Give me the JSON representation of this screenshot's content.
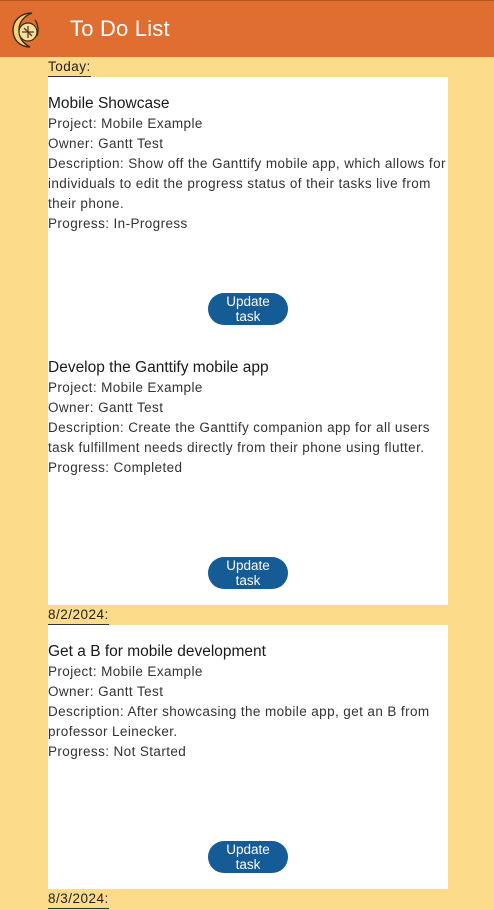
{
  "app": {
    "title": "To Do List",
    "logo_icon": "ganttify-logo-icon",
    "colors": {
      "appbar": "#E06E30",
      "background": "#FCDC8A",
      "button": "#155B96",
      "card": "#FFFFFF"
    }
  },
  "groups": [
    {
      "date": "Today:",
      "tasks": [
        {
          "title": "Mobile Showcase",
          "project": "Project: Mobile Example",
          "owner": "Owner: Gantt Test",
          "description": "Description: Show off the Ganttify mobile app, which allows for individuals to edit the progress status of their tasks live from their phone.",
          "progress": "Progress: In-Progress",
          "button": "Update task"
        },
        {
          "title": "Develop the Ganttify mobile app",
          "project": "Project: Mobile Example",
          "owner": "Owner: Gantt Test",
          "description": "Description: Create the Ganttify companion app for all users task fulfillment needs directly from their phone using flutter.",
          "progress": "Progress: Completed",
          "button": "Update task"
        }
      ]
    },
    {
      "date": "8/2/2024:",
      "tasks": [
        {
          "title": "Get a B for mobile development",
          "project": "Project: Mobile Example",
          "owner": "Owner: Gantt Test",
          "description": "Description: After showcasing the mobile app, get an B from professor Leinecker.",
          "progress": "Progress: Not Started",
          "button": "Update task"
        }
      ]
    },
    {
      "date": "8/3/2024:",
      "tasks": []
    }
  ]
}
